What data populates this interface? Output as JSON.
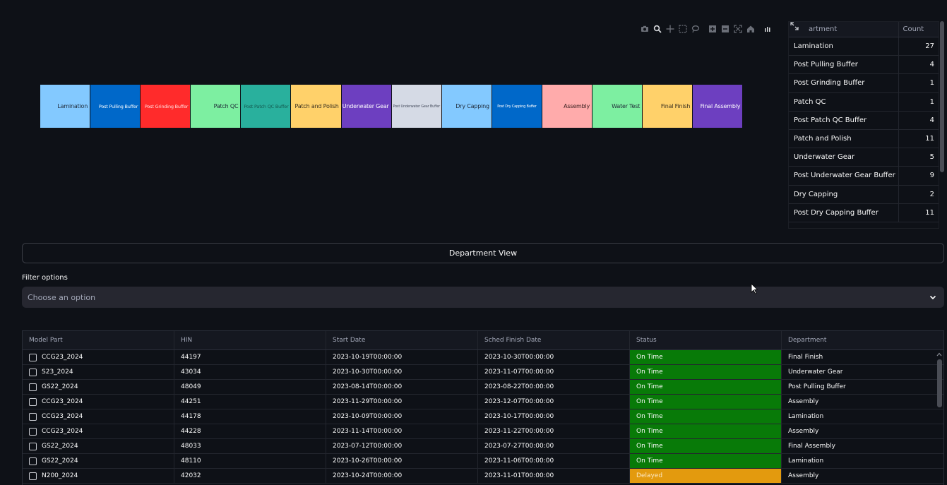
{
  "toolbar": {
    "icons": [
      "camera-icon",
      "zoom-icon",
      "pan-icon",
      "box-select-icon",
      "lasso-icon",
      "zoom-in-icon",
      "zoom-out-icon",
      "autoscale-icon",
      "home-icon",
      "plotly-logo-icon"
    ]
  },
  "treemap": {
    "tiles": [
      {
        "label": "Lamination",
        "color": "#83c9ff",
        "text": "#1f2937"
      },
      {
        "label": "Post Pulling Buffer",
        "color": "#0068c9",
        "text": "#ffffff"
      },
      {
        "label": "Post Grinding Buffer",
        "color": "#ff2b2b",
        "text": "#ffe4e4"
      },
      {
        "label": "Patch QC",
        "color": "#7defa1",
        "text": "#1f2937"
      },
      {
        "label": "Post Patch QC Buffer",
        "color": "#29b09d",
        "text": "#145a50"
      },
      {
        "label": "Patch and Polish",
        "color": "#ffd16a",
        "text": "#3a3020"
      },
      {
        "label": "Underwater Gear",
        "color": "#6d3fc0",
        "text": "#ffffff"
      },
      {
        "label": "Post Underwater Gear Buffer",
        "color": "#d5dae5",
        "text": "#4a5060"
      },
      {
        "label": "Dry Capping",
        "color": "#83c9ff",
        "text": "#1f2937"
      },
      {
        "label": "Post Dry Capping Buffer",
        "color": "#0068c9",
        "text": "#ffffff"
      },
      {
        "label": "Assembly",
        "color": "#ffabab",
        "text": "#3a2020"
      },
      {
        "label": "Water Test",
        "color": "#7defa1",
        "text": "#1f2937"
      },
      {
        "label": "Final Finish",
        "color": "#ffd16a",
        "text": "#3a3020"
      },
      {
        "label": "Final Assembly",
        "color": "#6d3fc0",
        "text": "#ffffff"
      }
    ]
  },
  "dept_table": {
    "col1": "artment",
    "col2": "Count",
    "rows": [
      {
        "department": "Lamination",
        "count": "27"
      },
      {
        "department": "Post Pulling Buffer",
        "count": "4"
      },
      {
        "department": "Post Grinding Buffer",
        "count": "1"
      },
      {
        "department": "Patch QC",
        "count": "1"
      },
      {
        "department": "Post Patch QC Buffer",
        "count": "4"
      },
      {
        "department": "Patch and Polish",
        "count": "11"
      },
      {
        "department": "Underwater Gear",
        "count": "5"
      },
      {
        "department": "Post Underwater Gear Buffer",
        "count": "9"
      },
      {
        "department": "Dry Capping",
        "count": "2"
      },
      {
        "department": "Post Dry Capping Buffer",
        "count": "11"
      }
    ]
  },
  "department_view_button": "Department View",
  "filter": {
    "label": "Filter options",
    "placeholder": "Choose an option"
  },
  "grid": {
    "headers": [
      "Model Part",
      "HIN",
      "Start Date",
      "Sched Finish Date",
      "Status",
      "Department"
    ],
    "rows": [
      {
        "model": "CCG23_2024",
        "hin": "44197",
        "start": "2023-10-19T00:00:00",
        "finish": "2023-10-30T00:00:00",
        "status": "On Time",
        "dept": "Final Finish"
      },
      {
        "model": "S23_2024",
        "hin": "43034",
        "start": "2023-10-30T00:00:00",
        "finish": "2023-11-07T00:00:00",
        "status": "On Time",
        "dept": "Underwater Gear"
      },
      {
        "model": "GS22_2024",
        "hin": "48049",
        "start": "2023-08-14T00:00:00",
        "finish": "2023-08-22T00:00:00",
        "status": "On Time",
        "dept": "Post Pulling Buffer"
      },
      {
        "model": "CCG23_2024",
        "hin": "44251",
        "start": "2023-11-29T00:00:00",
        "finish": "2023-12-07T00:00:00",
        "status": "On Time",
        "dept": "Assembly"
      },
      {
        "model": "CCG23_2024",
        "hin": "44178",
        "start": "2023-10-09T00:00:00",
        "finish": "2023-10-17T00:00:00",
        "status": "On Time",
        "dept": "Lamination"
      },
      {
        "model": "CCG23_2024",
        "hin": "44228",
        "start": "2023-11-14T00:00:00",
        "finish": "2023-11-22T00:00:00",
        "status": "On Time",
        "dept": "Assembly"
      },
      {
        "model": "GS22_2024",
        "hin": "48033",
        "start": "2023-07-12T00:00:00",
        "finish": "2023-07-27T00:00:00",
        "status": "On Time",
        "dept": "Final Assembly"
      },
      {
        "model": "GS22_2024",
        "hin": "48110",
        "start": "2023-10-26T00:00:00",
        "finish": "2023-11-06T00:00:00",
        "status": "On Time",
        "dept": "Lamination"
      },
      {
        "model": "N200_2024",
        "hin": "42032",
        "start": "2023-10-24T00:00:00",
        "finish": "2023-11-01T00:00:00",
        "status": "Delayed",
        "dept": "Assembly"
      }
    ]
  }
}
